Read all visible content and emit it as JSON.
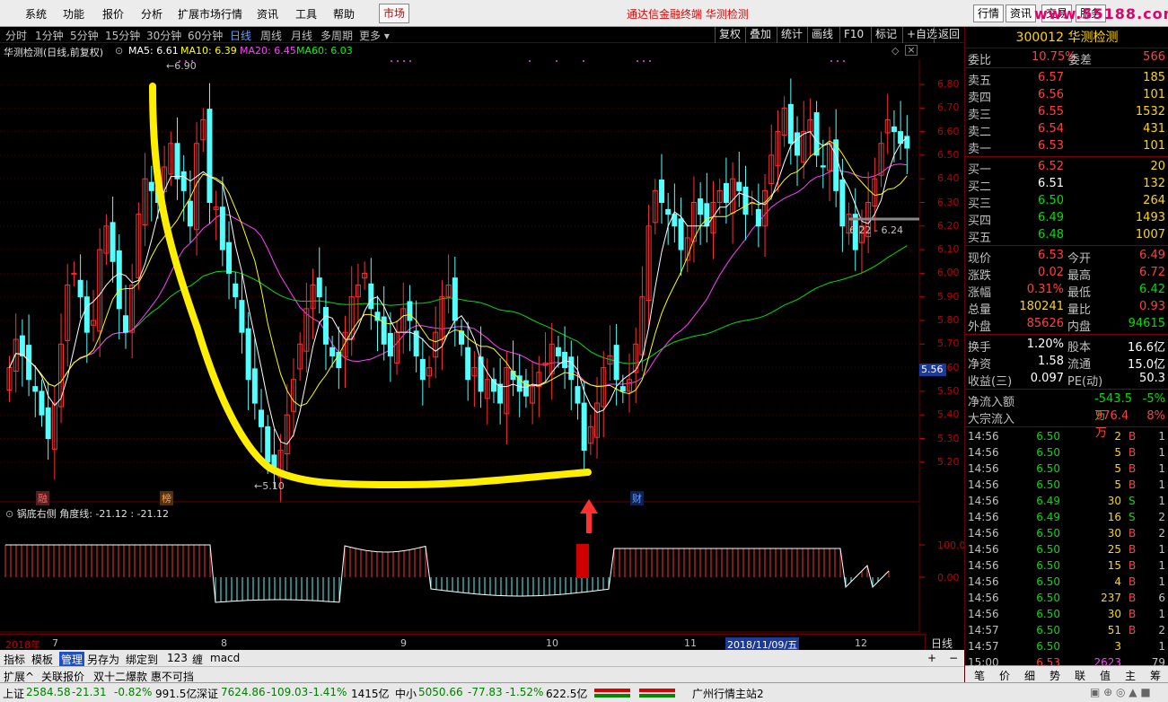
{
  "menu": {
    "items": [
      "系统",
      "功能",
      "报价",
      "分析",
      "扩展市场行情",
      "资讯",
      "工具",
      "帮助"
    ],
    "market_tab": "市场",
    "title": "通达信金融终端  华测检测",
    "right_buttons": [
      "行情",
      "资讯",
      "交易",
      "服务"
    ],
    "watermark": "www.55188.com"
  },
  "periods": [
    "分时",
    "1分钟",
    "5分钟",
    "15分钟",
    "30分钟",
    "60分钟",
    "日线",
    "周线",
    "月线",
    "多周期",
    "更多"
  ],
  "active_period": "日线",
  "toolbar": [
    "复权",
    "叠加",
    "统计",
    "画线",
    "F10",
    "标记",
    "+自选",
    "返回"
  ],
  "legend": {
    "title": "华测检测(日线,前复权)",
    "ma5": "MA5: 6.61",
    "ma10": "MA10: 6.39",
    "ma20": "MA20: 6.45",
    "ma60": "MA60: 6.03"
  },
  "price_axis": [
    "6.80",
    "6.70",
    "6.60",
    "6.50",
    "6.40",
    "6.30",
    "6.20",
    "6.10",
    "6.00",
    "5.90",
    "5.80",
    "5.70",
    "5.60",
    "5.50",
    "5.40",
    "5.30",
    "5.20"
  ],
  "current_price_marker": "5.56",
  "annotations": {
    "high": "6.90",
    "low": "5.10",
    "range": "6.22 - 6.24",
    "tags": [
      "融",
      "榜",
      "财"
    ]
  },
  "sub_chart": {
    "title": "锅底右侧",
    "legend": "角度线: -21.12  : -21.12",
    "axis": [
      "100.0",
      "0.00"
    ]
  },
  "dates": [
    "2018年",
    "7",
    "8",
    "9",
    "10",
    "11",
    "2018/11/09/五",
    "12"
  ],
  "day_button": "日线",
  "tools": [
    "指标",
    "模板",
    "管理",
    "另存为",
    "绑定到",
    "123",
    "缠",
    "macd"
  ],
  "ext": [
    "扩展^",
    "关联报价",
    "双十二爆款 惠不可挡"
  ],
  "status": {
    "sh_label": "上证",
    "sh": "2584.58",
    "sh_chg": "-21.31",
    "sh_pct": "-0.82%",
    "sh_amt": "991.5亿",
    "sz_label": "深证",
    "sz": "7624.86",
    "sz_chg": "-109.03",
    "sz_pct": "-1.41%",
    "sz_amt": "1415亿",
    "zx_label": "中小",
    "zx": "5050.66",
    "zx_chg": "-77.83",
    "zx_pct": "-1.52%",
    "zx_amt": "622.5亿",
    "server": "广州行情主站2"
  },
  "stock": {
    "code_name": "300012 华测检测",
    "weibi_label": "委比",
    "weibi": "10.75%",
    "weicha_label": "委差",
    "weicha": "566",
    "asks": [
      {
        "l": "卖五",
        "p": "6.57",
        "v": "185"
      },
      {
        "l": "卖四",
        "p": "6.56",
        "v": "101"
      },
      {
        "l": "卖三",
        "p": "6.55",
        "v": "1532"
      },
      {
        "l": "卖二",
        "p": "6.54",
        "v": "431"
      },
      {
        "l": "卖一",
        "p": "6.53",
        "v": "101"
      }
    ],
    "bids": [
      {
        "l": "买一",
        "p": "6.52",
        "v": "20"
      },
      {
        "l": "买二",
        "p": "6.51",
        "v": "132"
      },
      {
        "l": "买三",
        "p": "6.50",
        "v": "264"
      },
      {
        "l": "买四",
        "p": "6.49",
        "v": "1493"
      },
      {
        "l": "买五",
        "p": "6.48",
        "v": "1007"
      }
    ],
    "quote": [
      {
        "a": "现价",
        "av": "6.53",
        "b": "今开",
        "bv": "6.49"
      },
      {
        "a": "涨跌",
        "av": "0.02",
        "b": "最高",
        "bv": "6.72"
      },
      {
        "a": "涨幅",
        "av": "0.31%",
        "b": "最低",
        "bv": "6.42"
      },
      {
        "a": "总量",
        "av": "180241",
        "b": "量比",
        "bv": "0.93"
      },
      {
        "a": "外盘",
        "av": "85626",
        "b": "内盘",
        "bv": "94615"
      }
    ],
    "fin": [
      {
        "a": "换手",
        "av": "1.20%",
        "b": "股本",
        "bv": "16.6亿"
      },
      {
        "a": "净资",
        "av": "1.58",
        "b": "流通",
        "bv": "15.0亿"
      },
      {
        "a": "收益(三)",
        "av": "0.097",
        "b": "PE(动)",
        "bv": "50.3"
      }
    ],
    "flow": [
      {
        "a": "净流入额",
        "v": "-543.5万",
        "p": "-5%"
      },
      {
        "a": "大宗流入",
        "v": "976.4万",
        "p": "8%"
      }
    ],
    "ticks": [
      {
        "t": "14:56",
        "p": "6.50",
        "v": "2",
        "s": "B",
        "n": "1"
      },
      {
        "t": "14:56",
        "p": "6.50",
        "v": "5",
        "s": "B",
        "n": "1"
      },
      {
        "t": "14:56",
        "p": "6.50",
        "v": "5",
        "s": "B",
        "n": "1"
      },
      {
        "t": "14:56",
        "p": "6.50",
        "v": "5",
        "s": "B",
        "n": "1"
      },
      {
        "t": "14:56",
        "p": "6.49",
        "v": "30",
        "s": "S",
        "n": "1"
      },
      {
        "t": "14:56",
        "p": "6.49",
        "v": "16",
        "s": "S",
        "n": "2"
      },
      {
        "t": "14:56",
        "p": "6.50",
        "v": "30",
        "s": "B",
        "n": "2"
      },
      {
        "t": "14:56",
        "p": "6.50",
        "v": "25",
        "s": "B",
        "n": "1"
      },
      {
        "t": "14:56",
        "p": "6.50",
        "v": "15",
        "s": "B",
        "n": "1"
      },
      {
        "t": "14:56",
        "p": "6.50",
        "v": "4",
        "s": "B",
        "n": "1"
      },
      {
        "t": "14:56",
        "p": "6.50",
        "v": "237",
        "s": "B",
        "n": "6"
      },
      {
        "t": "14:56",
        "p": "6.50",
        "v": "30",
        "s": "B",
        "n": "1"
      },
      {
        "t": "14:57",
        "p": "6.50",
        "v": "51",
        "s": "B",
        "n": "2"
      },
      {
        "t": "14:57",
        "p": "6.50",
        "v": "3",
        "s": "",
        "n": "1"
      },
      {
        "t": "15:00",
        "p": "6.53",
        "v": "2623",
        "s": "",
        "n": "79"
      }
    ],
    "tabs": [
      "笔",
      "价",
      "细",
      "势",
      "联",
      "值",
      "主",
      "筹"
    ]
  }
}
